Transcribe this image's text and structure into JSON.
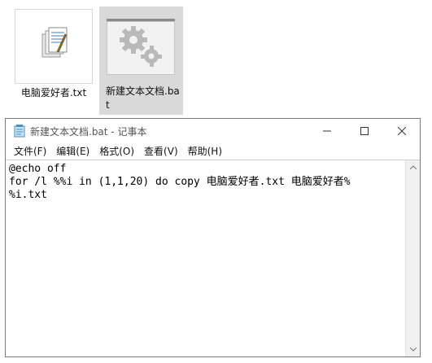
{
  "desktop": {
    "files": [
      {
        "name": "电脑爱好者.txt",
        "icon": "text-file-icon"
      },
      {
        "name": "新建文本文档.bat",
        "icon": "batch-file-gears-icon"
      }
    ]
  },
  "window": {
    "title": "新建文本文档.bat - 记事本",
    "controls": [
      "minimize-icon",
      "maximize-icon",
      "close-icon"
    ],
    "menu": [
      "文件(F)",
      "编辑(E)",
      "格式(O)",
      "查看(V)",
      "帮助(H)"
    ],
    "content": {
      "line1": "@echo off",
      "line2": "for /l %%i in (1,1,20) do copy 电脑爱好者.txt 电脑爱好者%",
      "line3": "%i.txt"
    }
  }
}
